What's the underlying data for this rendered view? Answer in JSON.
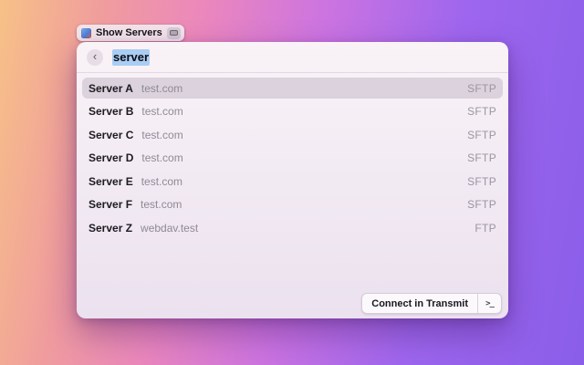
{
  "colors": {
    "bg-grad-1": "#f7c187",
    "bg-grad-2": "#f09d9d",
    "bg-grad-3": "#eb87bd",
    "bg-grad-4": "#cd74e0",
    "bg-grad-5": "#9e66ee",
    "bg-grad-6": "#8a5ee9",
    "panel-top": "#f9f3f7",
    "panel-bottom": "#ebe1ef",
    "row-highlight": "#dbd2dd",
    "selection": "#a9cdf3",
    "muted-text": "#8f8a96",
    "protocol-text": "#9b95a2"
  },
  "launcher": {
    "label": "Show Servers",
    "app_icon": "transmit-app-icon",
    "shortcut_icon": "keyboard-key-icon"
  },
  "panel": {
    "search": {
      "back_glyph": "‹",
      "value": "server",
      "value_selected": true
    },
    "servers": [
      {
        "name": "Server A",
        "host": "test.com",
        "protocol": "SFTP",
        "selected": true
      },
      {
        "name": "Server B",
        "host": "test.com",
        "protocol": "SFTP",
        "selected": false
      },
      {
        "name": "Server C",
        "host": "test.com",
        "protocol": "SFTP",
        "selected": false
      },
      {
        "name": "Server D",
        "host": "test.com",
        "protocol": "SFTP",
        "selected": false
      },
      {
        "name": "Server E",
        "host": "test.com",
        "protocol": "SFTP",
        "selected": false
      },
      {
        "name": "Server F",
        "host": "test.com",
        "protocol": "SFTP",
        "selected": false
      },
      {
        "name": "Server Z",
        "host": "webdav.test",
        "protocol": "FTP",
        "selected": false
      }
    ],
    "footer": {
      "connect_label": "Connect in Transmit",
      "terminal_glyph": ">_"
    }
  }
}
